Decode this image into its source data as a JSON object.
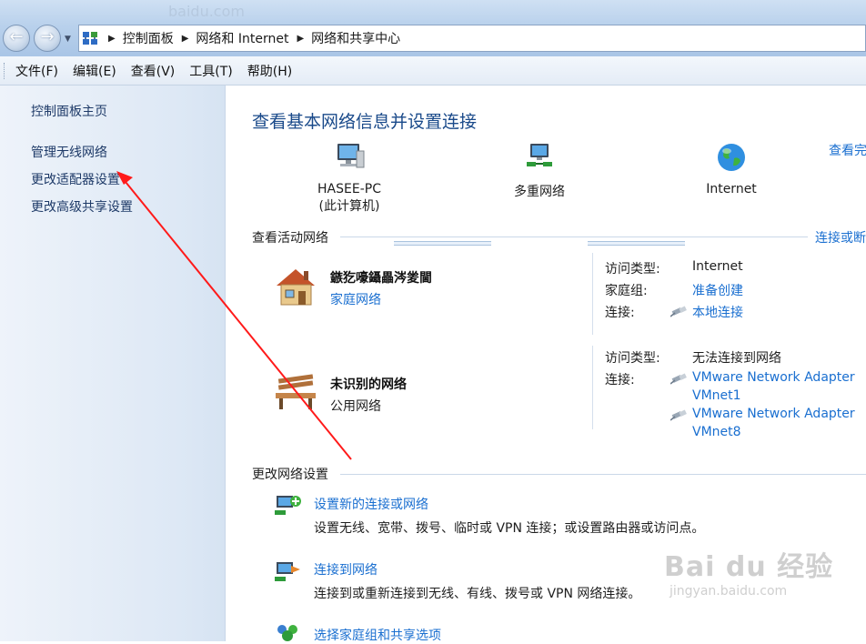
{
  "window": {
    "faded_url": "baidu.com",
    "breadcrumbs": [
      "控制面板",
      "网络和 Internet",
      "网络和共享中心"
    ]
  },
  "menubar": {
    "items": [
      "文件(F)",
      "编辑(E)",
      "查看(V)",
      "工具(T)",
      "帮助(H)"
    ]
  },
  "sidebar": {
    "items": [
      {
        "label": "控制面板主页"
      },
      {
        "label": "管理无线网络"
      },
      {
        "label": "更改适配器设置"
      },
      {
        "label": "更改高级共享设置"
      }
    ]
  },
  "main": {
    "title": "查看基本网络信息并设置连接",
    "see_full_map": "查看完",
    "map": {
      "computer_name": "HASEE-PC",
      "computer_sub": "(此计算机)",
      "network": "多重网络",
      "internet": "Internet"
    },
    "active_networks": {
      "heading": "查看活动网络",
      "right_link": "连接或断",
      "networks": [
        {
          "name": "鏃犵嚎鑷畾涔夎閫",
          "type": "家庭网络",
          "access_type_label": "访问类型:",
          "access_type_value": "Internet",
          "homegroup_label": "家庭组:",
          "homegroup_value": "准备创建",
          "connection_label": "连接:",
          "connection_value": "本地连接"
        },
        {
          "name": "未识别的网络",
          "type": "公用网络",
          "access_type_label": "访问类型:",
          "access_type_value": "无法连接到网络",
          "connection_label": "连接:",
          "connections": [
            {
              "line1": "VMware Network Adapter",
              "line2": "VMnet1"
            },
            {
              "line1": "VMware Network Adapter",
              "line2": "VMnet8"
            }
          ]
        }
      ]
    },
    "change_settings": {
      "heading": "更改网络设置",
      "tasks": [
        {
          "link": "设置新的连接或网络",
          "desc": "设置无线、宽带、拨号、临时或 VPN 连接；或设置路由器或访问点。"
        },
        {
          "link": "连接到网络",
          "desc": "连接到或重新连接到无线、有线、拨号或 VPN 网络连接。"
        },
        {
          "link": "选择家庭组和共享选项",
          "desc": ""
        }
      ]
    }
  },
  "watermark": {
    "brand": "Bai du 经验",
    "url": "jingyan.baidu.com"
  },
  "colors": {
    "link": "#1a6fd0",
    "title": "#1a4a8a",
    "annotation_arrow": "#ff1a1a",
    "sidebar_bg": "#dde8f5"
  }
}
